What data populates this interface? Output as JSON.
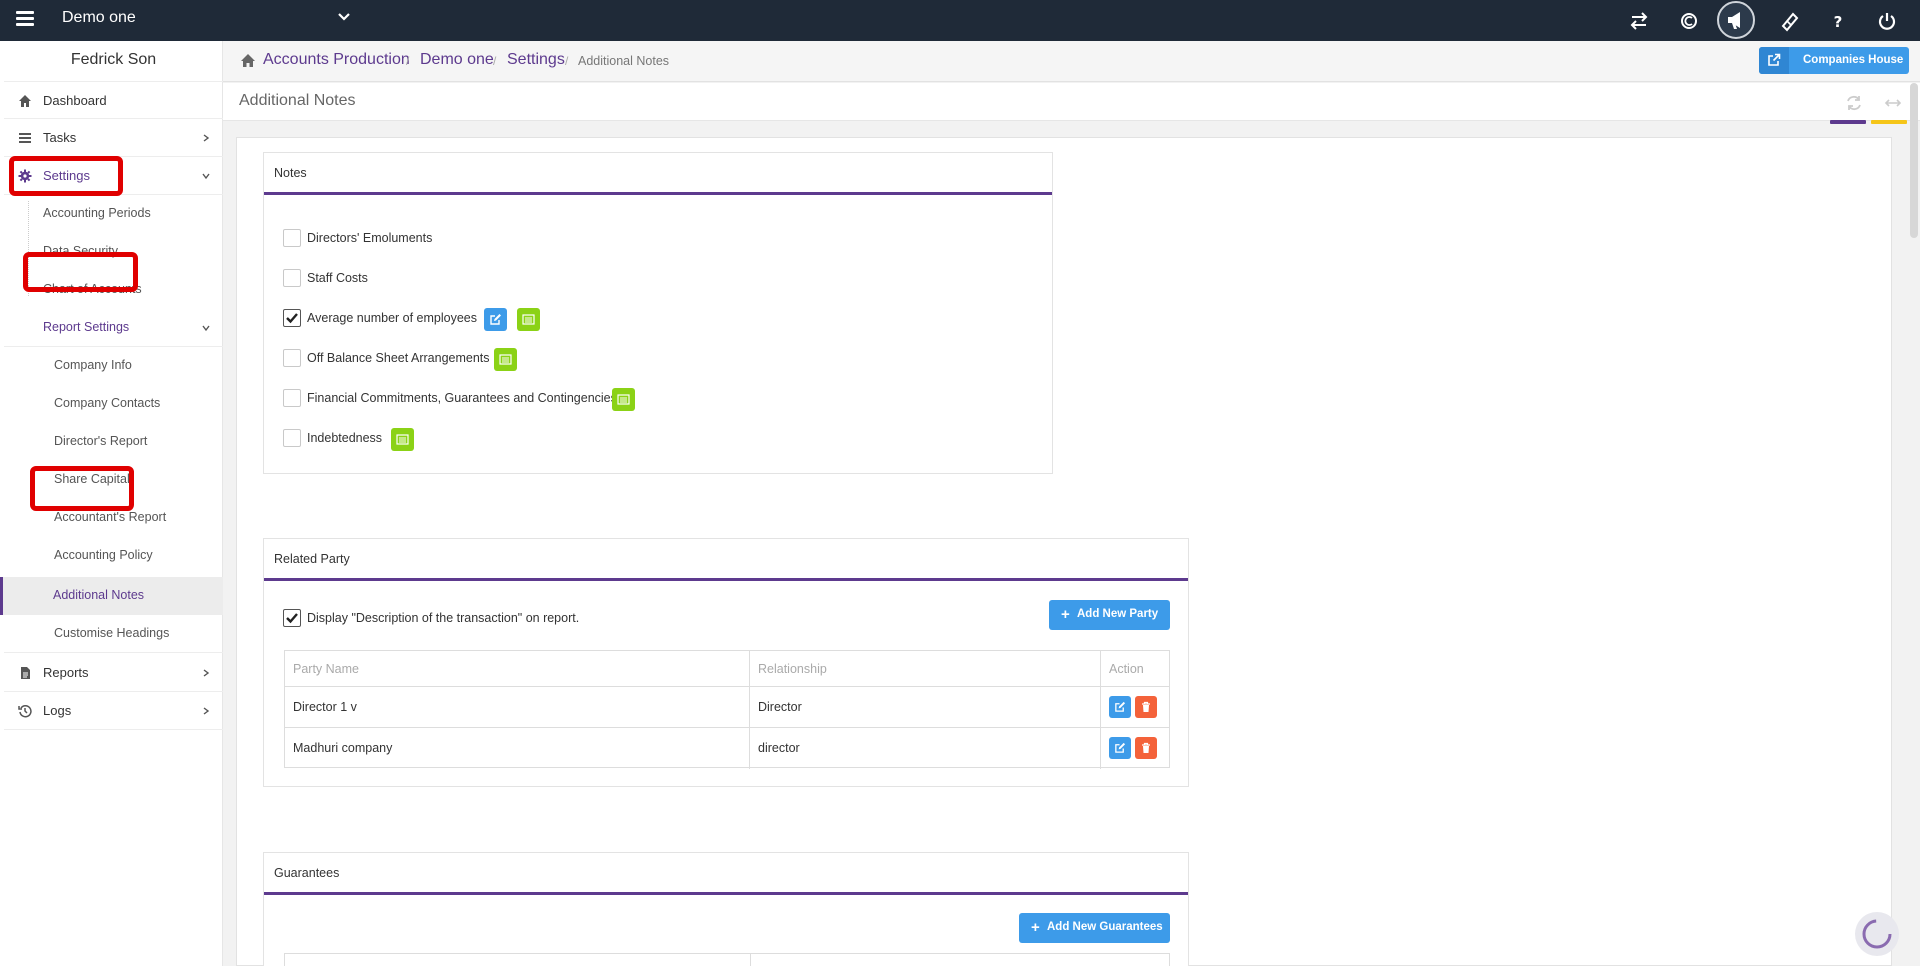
{
  "topbar": {
    "company": "Demo one",
    "icons": [
      "transfer-icon",
      "coin-icon",
      "megaphone-icon",
      "ticket-icon",
      "help-icon",
      "power-icon"
    ]
  },
  "sidebar": {
    "user_name": "Fedrick Son",
    "items": {
      "dashboard": "Dashboard",
      "tasks": "Tasks",
      "settings": "Settings",
      "accounting_periods": "Accounting Periods",
      "data_security": "Data Security",
      "chart_of_accounts": "Chart of Accounts",
      "report_settings": "Report Settings",
      "company_info": "Company Info",
      "company_contacts": "Company Contacts",
      "directors_report": "Director's Report",
      "share_capital": "Share Capital",
      "accountants_report": "Accountant's Report",
      "accounting_policy": "Accounting Policy",
      "additional_notes": "Additional Notes",
      "customise_headings": "Customise Headings",
      "reports": "Reports",
      "logs": "Logs"
    }
  },
  "breadcrumb": {
    "items": [
      "Accounts Production",
      "Demo one",
      "Settings"
    ],
    "current": "Additional Notes",
    "separator": "/"
  },
  "companies_house_button": "Companies House",
  "page_title": "Additional Notes",
  "notes_card": {
    "title": "Notes",
    "items": [
      {
        "label": "Directors' Emoluments",
        "checked": false
      },
      {
        "label": "Staff Costs",
        "checked": false
      },
      {
        "label": "Average number of employees",
        "checked": true
      },
      {
        "label": "Off Balance Sheet Arrangements",
        "checked": false
      },
      {
        "label": "Financial Commitments, Guarantees and Contingencies",
        "checked": false
      },
      {
        "label": "Indebtedness",
        "checked": false
      }
    ]
  },
  "related_party_card": {
    "title": "Related Party",
    "display_description_label": "Display \"Description of the transaction\" on report.",
    "display_description_checked": true,
    "add_button": "Add New Party",
    "columns": [
      "Party Name",
      "Relationship",
      "Action"
    ],
    "rows": [
      {
        "party_name": "Director 1 v",
        "relationship": "Director"
      },
      {
        "party_name": "Madhuri company",
        "relationship": "director"
      }
    ]
  },
  "guarantees_card": {
    "title": "Guarantees",
    "add_button": "Add New Guarantees"
  },
  "colors": {
    "topbar": "#1f2a38",
    "accent_purple": "#5d3a8e",
    "blue_button": "#3d9be9",
    "green_button": "#8bd216",
    "red_button": "#f4623a",
    "highlight_red": "#e00000",
    "yellow_underline": "#f5c518"
  }
}
